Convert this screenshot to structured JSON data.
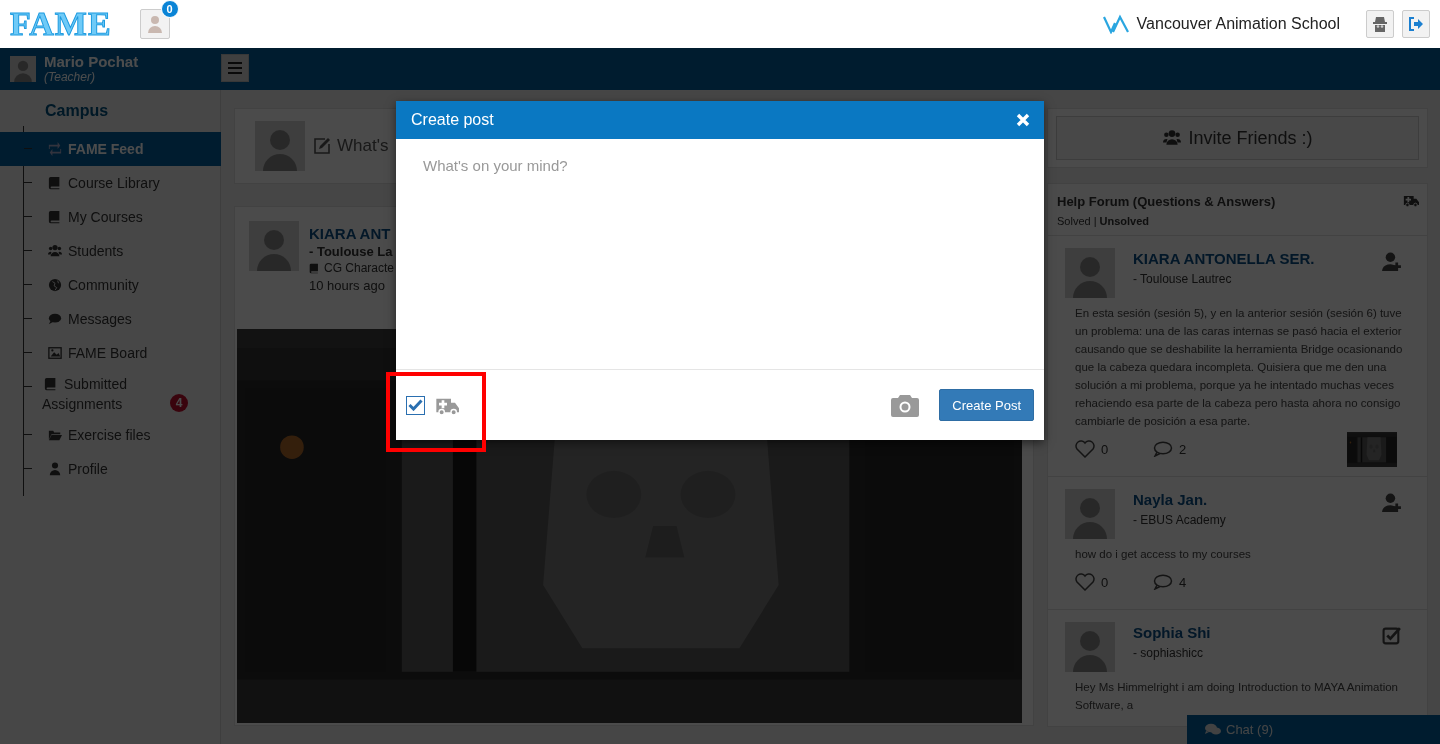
{
  "header": {
    "logo": "FAME",
    "notifications": {
      "count": "0"
    },
    "school": "Vancouver Animation School"
  },
  "user": {
    "name": "Mario Pochat",
    "role": "(Teacher)"
  },
  "sidebar": {
    "heading": "Campus",
    "items": [
      {
        "label": "FAME Feed",
        "selected": true
      },
      {
        "label": "Course Library",
        "selected": false
      },
      {
        "label": "My Courses",
        "selected": false
      },
      {
        "label": "Students",
        "selected": false
      },
      {
        "label": "Community",
        "selected": false
      },
      {
        "label": "Messages",
        "selected": false
      },
      {
        "label": "FAME Board",
        "selected": false
      },
      {
        "label": "Submitted Assignments",
        "selected": false,
        "badge": "4"
      },
      {
        "label": "Exercise files",
        "selected": false
      },
      {
        "label": "Profile",
        "selected": false
      }
    ]
  },
  "composer": {
    "prompt": "What's"
  },
  "post": {
    "author": "KIARA ANT",
    "school": "- Toulouse La",
    "course": "CG Characte",
    "time": "10 hours ago"
  },
  "invite": {
    "label": "Invite Friends :)"
  },
  "forum": {
    "title": "Help Forum (Questions & Answers)",
    "separator": "|",
    "filters": [
      {
        "label": "Solved",
        "selected": false
      },
      {
        "label": "Unsolved",
        "selected": true
      }
    ],
    "posts": [
      {
        "name": "KIARA ANTONELLA SER.",
        "school": "- Toulouse Lautrec",
        "kind": "add_friend",
        "text": "En esta sesión (sesión 5), y en la anterior sesión (sesión 6) tuve un problema: una de las caras internas se pasó hacia el exterior causando que se deshabilite la herramienta Bridge ocasionando que la cabeza quedara incompleta. Quisiera que me den una solución a mi problema, porque ya he intentado muchas veces rehaciendo esa parte de la cabeza pero hasta ahora no consigo cambiarle de posición a esa parte.",
        "likes": "0",
        "comments": "2"
      },
      {
        "name": "Nayla Jan.",
        "school": "- EBUS Academy",
        "kind": "add_friend",
        "text": "how do i get access to my courses",
        "likes": "0",
        "comments": "4"
      },
      {
        "name": "Sophia Shi",
        "school": "- sophiashicc",
        "kind": "solved",
        "text": "Hey Ms Himmelright i am doing Introduction to MAYA Animation Software, a"
      }
    ]
  },
  "chat": {
    "label": "Chat (9)"
  },
  "modal": {
    "title": "Create post",
    "placeholder": "What's on your mind?",
    "help_request": {
      "checked": true
    },
    "button": "Create Post"
  }
}
